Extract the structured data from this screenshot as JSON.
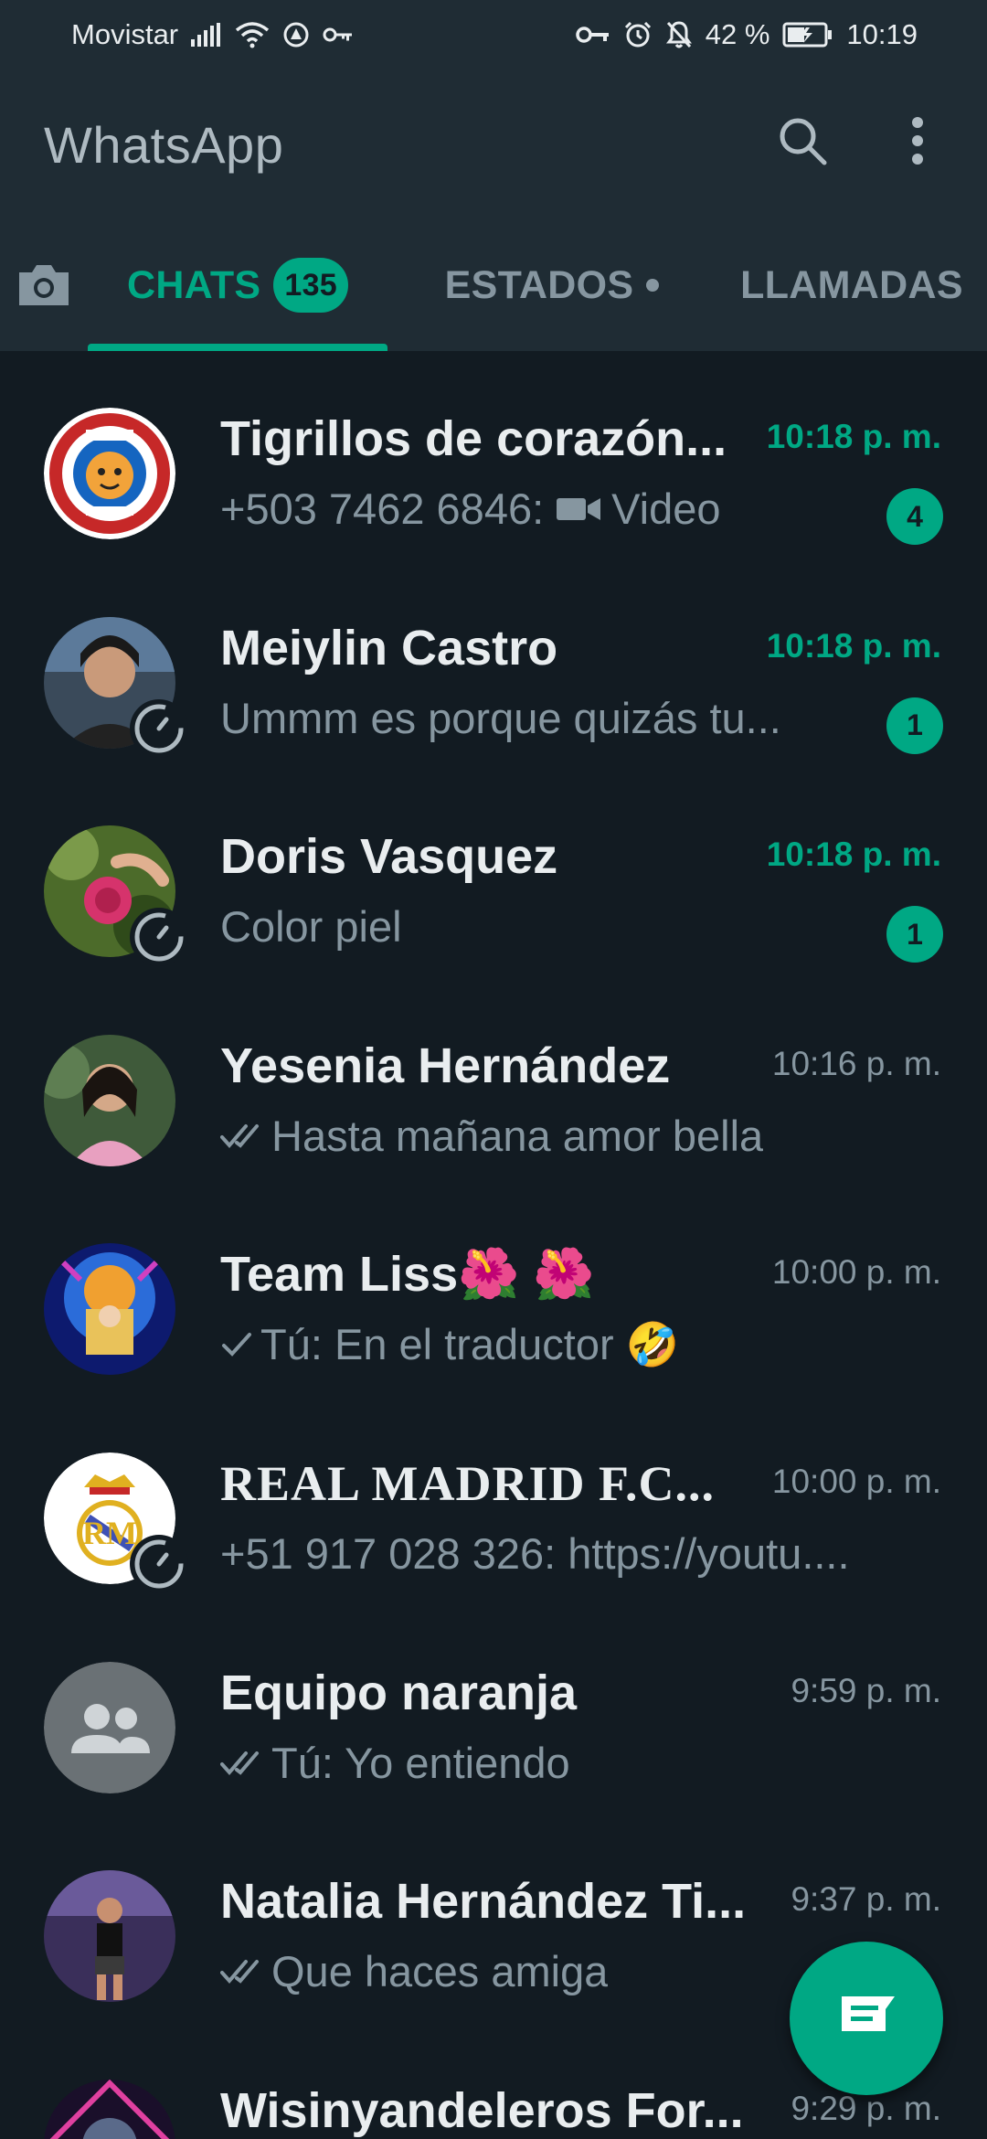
{
  "status_bar": {
    "carrier": "Movistar",
    "battery_percent": "42 %",
    "time": "10:19"
  },
  "app_bar": {
    "title": "WhatsApp",
    "search_icon": "search-icon",
    "menu_icon": "more-vert-icon"
  },
  "tabs": {
    "camera_icon": "camera-icon",
    "chats_label": "CHATS",
    "chats_badge": "135",
    "estados_label": "ESTADOS",
    "llamadas_label": "LLAMADAS"
  },
  "chats": [
    {
      "name": "Tigrillos de corazón...",
      "time": "10:18 p. m.",
      "sender": "+503 7462 6846:",
      "message": "Video",
      "unread": "4",
      "media": "video-icon"
    },
    {
      "name": "Meiylin Castro",
      "time": "10:18 p. m.",
      "message": "Ummm es porque quizás tu...",
      "unread": "1"
    },
    {
      "name": "Doris Vasquez",
      "time": "10:18 p. m.",
      "message": "Color piel",
      "unread": "1"
    },
    {
      "name": "Yesenia Hernández",
      "time": "10:16 p. m.",
      "message": "Hasta mañana amor bella",
      "tick": "double-check-icon"
    },
    {
      "name": "Team Liss🌺 🌺",
      "time": "10:00 p. m.",
      "message": "Tú: En el traductor 🤣",
      "tick": "single-check-icon"
    },
    {
      "name": "REAL MADRID F.C...",
      "time": "10:00 p. m.",
      "message": "+51 917 028 326: https://youtu...."
    },
    {
      "name": "Equipo naranja",
      "time": "9:59 p. m.",
      "message": "Tú: Yo entiendo",
      "tick": "double-check-icon"
    },
    {
      "name": "Natalia Hernández Ti...",
      "time": "9:37 p. m.",
      "message": "Que haces amiga",
      "tick": "double-check-icon"
    },
    {
      "name": "Wisinyandeleros For...",
      "time": "9:29 p. m.",
      "message": ""
    }
  ],
  "fab": {
    "icon": "new-chat-icon"
  },
  "colors": {
    "accent": "#00a884",
    "background": "#121b22",
    "header": "#1f2c34",
    "secondary_text": "#8696a0"
  }
}
